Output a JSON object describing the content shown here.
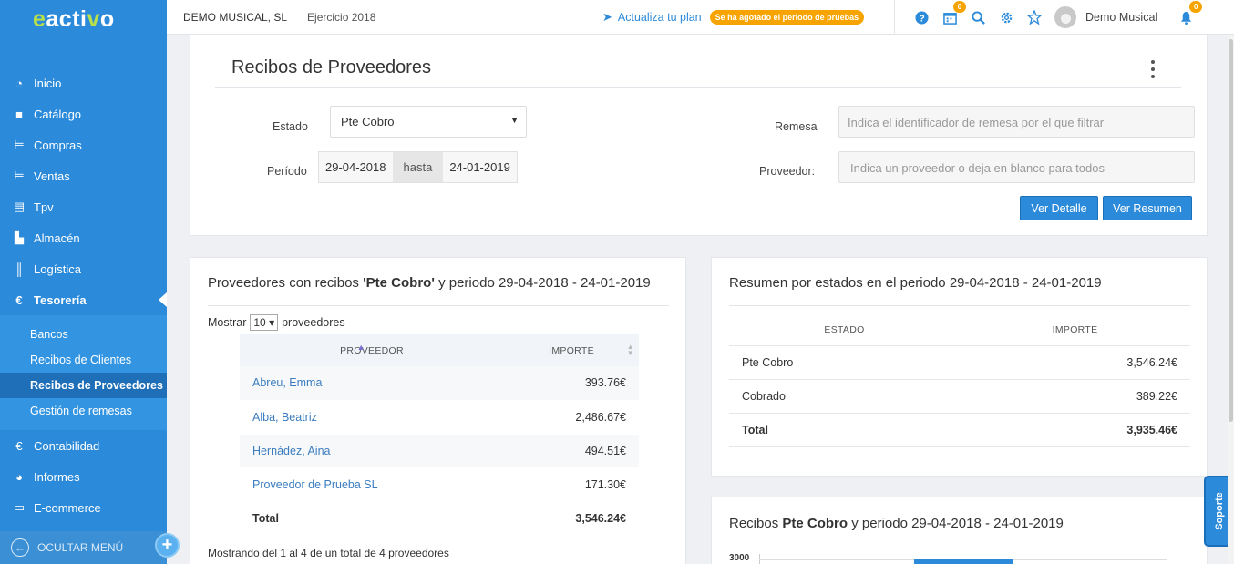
{
  "brand": {
    "logo_pre": "e",
    "logo_mid": "acti",
    "logo_v": "v",
    "logo_post": "o"
  },
  "topbar": {
    "company": "DEMO MUSICAL, SL",
    "ejercicio": "Ejercicio 2018",
    "upgrade_label": "Actualiza tu plan",
    "trial_badge": "Se ha agotado el periodo de pruebas",
    "calendar_count": "0",
    "notification_count": "0",
    "username": "Demo Musical"
  },
  "sidebar": {
    "items": [
      {
        "label": "Inicio",
        "icon": "dashboard-icon"
      },
      {
        "label": "Catálogo",
        "icon": "box-icon"
      },
      {
        "label": "Compras",
        "icon": "cart-icon"
      },
      {
        "label": "Ventas",
        "icon": "cart-out-icon"
      },
      {
        "label": "Tpv",
        "icon": "register-icon"
      },
      {
        "label": "Almacén",
        "icon": "warehouse-icon"
      },
      {
        "label": "Logística",
        "icon": "barcode-icon"
      },
      {
        "label": "Tesorería",
        "icon": "euro-icon"
      }
    ],
    "sub_items": [
      {
        "label": "Bancos"
      },
      {
        "label": "Recibos de Clientes"
      },
      {
        "label": "Recibos de Proveedores"
      },
      {
        "label": "Gestión de remesas"
      }
    ],
    "bottom_items": [
      {
        "label": "Contabilidad",
        "icon": "euro-icon"
      },
      {
        "label": "Informes",
        "icon": "pie-chart-icon"
      },
      {
        "label": "E-commerce",
        "icon": "store-icon"
      }
    ],
    "hide_label": "OCULTAR MENÚ"
  },
  "filter": {
    "title": "Recibos de Proveedores",
    "estado_label": "Estado",
    "estado_value": "Pte Cobro",
    "periodo_label": "Período",
    "date_from": "29-04-2018",
    "date_sep": "hasta",
    "date_to": "24-01-2019",
    "remesa_label": "Remesa",
    "remesa_placeholder": "Indica el identificador de remesa por el que filtrar",
    "proveedor_label": "Proveedor:",
    "proveedor_placeholder": "Indica un proveedor o deja en blanco para todos",
    "btn_detalle": "Ver Detalle",
    "btn_resumen": "Ver Resumen"
  },
  "proveedores": {
    "title_pre": "Proveedores con recibos ",
    "title_state": "'Pte Cobro'",
    "title_post": " y periodo 29-04-2018 - 24-01-2019",
    "show_pre": "Mostrar",
    "show_value": "10",
    "show_post": "proveedores",
    "col_proveedor": "PROVEEDOR",
    "col_importe": "IMPORTE",
    "rows": [
      {
        "name": "Abreu, Emma",
        "amount": "393.76€"
      },
      {
        "name": "Alba, Beatriz",
        "amount": "2,486.67€"
      },
      {
        "name": "Hernádez, Aina",
        "amount": "494.51€"
      },
      {
        "name": "Proveedor de Prueba SL",
        "amount": "171.30€"
      }
    ],
    "total_label": "Total",
    "total_amount": "3,546.24€",
    "showing": "Mostrando del 1 al 4 de un total de 4 proveedores"
  },
  "resumen": {
    "title": "Resumen por estados en el periodo 29-04-2018 - 24-01-2019",
    "col_estado": "ESTADO",
    "col_importe": "IMPORTE",
    "rows": [
      {
        "estado": "Pte Cobro",
        "importe": "3,546.24€"
      },
      {
        "estado": "Cobrado",
        "importe": "389.22€"
      }
    ],
    "total_label": "Total",
    "total_importe": "3,935.46€"
  },
  "chart": {
    "title_pre": "Recibos ",
    "title_state": "Pte Cobro",
    "title_post": " y periodo 29-04-2018 - 24-01-2019",
    "y_tick_top": "3000"
  },
  "chart_data": {
    "type": "bar",
    "title": "Recibos Pte Cobro y periodo 29-04-2018 - 24-01-2019",
    "yticks": [
      3000
    ]
  },
  "soporte_label": "Soporte",
  "colors": {
    "brand_blue": "#2b8ad9",
    "accent_orange": "#f7a400",
    "logo_green": "#b8e04a"
  }
}
